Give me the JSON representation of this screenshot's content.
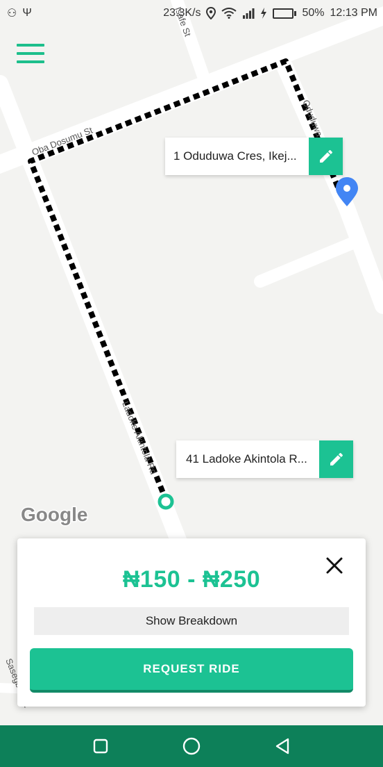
{
  "status_bar": {
    "speed": "23.3K/s",
    "battery": "50%",
    "battery_level": 0.5,
    "time": "12:13 PM"
  },
  "map": {
    "roads": {
      "top_road": "Oba Dosumu St",
      "top_right_road": "Isafe St",
      "right_road": "Oduduwa",
      "left_road": "Ladoke Akintola Rd",
      "bottom_left_road": "Sasegbon St"
    },
    "attribution": "Google"
  },
  "pickup": {
    "address": "1 Oduduwa Cres, Ikej..."
  },
  "destination": {
    "address": "41 Ladoke Akintola R..."
  },
  "fare": {
    "price_range": "₦150 - ₦250",
    "breakdown_label": "Show Breakdown",
    "request_label": "REQUEST RIDE"
  },
  "icons": {
    "menu": "menu-icon",
    "edit": "pencil-icon",
    "close": "close-icon",
    "pickup_pin": "location-pin-icon",
    "destination_marker": "destination-dot-icon"
  },
  "colors": {
    "accent": "#1cc293",
    "nav_bar": "#0d8059",
    "pin": "#4285f4"
  }
}
